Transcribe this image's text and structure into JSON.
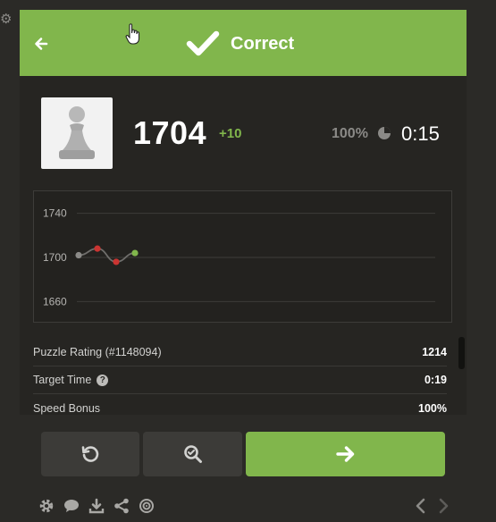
{
  "banner": {
    "title": "Correct",
    "color": "#81b64c"
  },
  "player": {
    "rating": "1704",
    "rating_change": "+10",
    "accuracy": "100%",
    "time": "0:15"
  },
  "chart_data": {
    "type": "line",
    "title": "",
    "xlabel": "",
    "ylabel": "",
    "ylim": [
      1640,
      1760
    ],
    "yticks": [
      "1740",
      "1700",
      "1660"
    ],
    "grid": true,
    "series": [
      {
        "values": [
          1702,
          1708,
          1696,
          1704
        ],
        "point_colors": [
          "#8b8a87",
          "#ca3431",
          "#ca3431",
          "#81b64c"
        ]
      }
    ]
  },
  "stats": [
    {
      "label": "Puzzle Rating (#1148094)",
      "value": "1214"
    },
    {
      "label": "Target Time",
      "value": "0:19",
      "has_help": true
    },
    {
      "label": "Speed Bonus",
      "value": "100%"
    }
  ],
  "icons": {
    "back": "arrow-left-icon",
    "check": "checkmark-icon",
    "retry": "retry-icon",
    "analyze": "magnifier-icon",
    "next": "arrow-right-icon",
    "footer": [
      "gear-icon",
      "chat-icon",
      "download-icon",
      "share-icon",
      "target-icon"
    ]
  },
  "colors": {
    "green": "#81b64c",
    "red": "#ca3431",
    "panel": "#262522"
  }
}
